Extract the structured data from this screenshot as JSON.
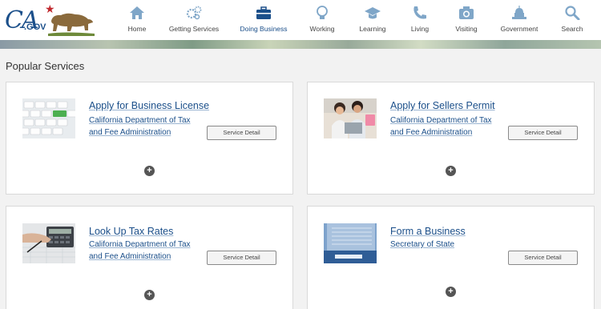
{
  "header": {
    "logo_text": "CA",
    "logo_sub": ".GOV",
    "nav": [
      {
        "label": "Home",
        "icon": "home-icon"
      },
      {
        "label": "Getting Services",
        "icon": "gears-icon"
      },
      {
        "label": "Doing Business",
        "icon": "briefcase-icon"
      },
      {
        "label": "Working",
        "icon": "lightbulb-icon"
      },
      {
        "label": "Learning",
        "icon": "graduation-cap-icon"
      },
      {
        "label": "Living",
        "icon": "phone-icon"
      },
      {
        "label": "Visiting",
        "icon": "camera-icon"
      },
      {
        "label": "Government",
        "icon": "capitol-icon"
      },
      {
        "label": "Search",
        "icon": "search-icon"
      }
    ],
    "active_nav": "Doing Business",
    "accent_color": "#1b4f8a"
  },
  "main": {
    "section_title": "Popular Services",
    "cards": [
      {
        "title": "Apply for Business License",
        "org": "California Department of Tax and Fee Administration",
        "button": "Service Detail",
        "image": "keyboard-image"
      },
      {
        "title": "Apply for Sellers Permit",
        "org": "California Department of Tax and Fee Administration",
        "button": "Service Detail",
        "image": "people-laptop-image"
      },
      {
        "title": "Look Up Tax Rates",
        "org": "California Department of Tax and Fee Administration",
        "button": "Service Detail",
        "image": "calculator-image"
      },
      {
        "title": "Form a Business",
        "org": "Secretary of State",
        "button": "Service Detail",
        "image": "documents-image"
      }
    ]
  }
}
